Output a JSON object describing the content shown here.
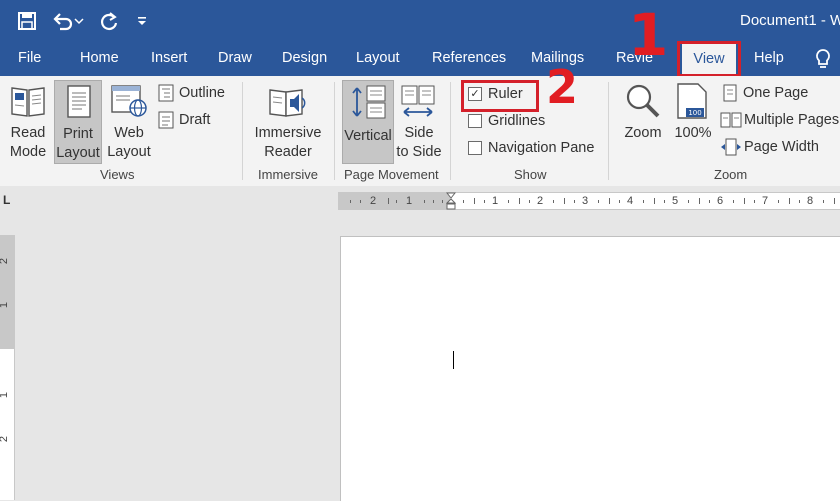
{
  "title_bar": {
    "document_title": "Document1  -  W",
    "icons": [
      "save-icon",
      "undo-icon",
      "undo-dropdown-icon",
      "redo-icon",
      "customize-qat-icon"
    ]
  },
  "tabs": [
    "File",
    "Home",
    "Insert",
    "Draw",
    "Design",
    "Layout",
    "References",
    "Mailings",
    "Revie",
    "View",
    "Help"
  ],
  "active_tab": "View",
  "tell_me_icon": "lightbulb-icon",
  "annotations": {
    "step1": "1",
    "step2": "2",
    "color": "#e11d22"
  },
  "ribbon": {
    "views": {
      "group_label": "Views",
      "read_mode": [
        "Read",
        "Mode"
      ],
      "print_layout": [
        "Print",
        "Layout"
      ],
      "web_layout": [
        "Web",
        "Layout"
      ],
      "outline": "Outline",
      "draft": "Draft"
    },
    "immersive": {
      "group_label": "Immersive",
      "immersive_reader": [
        "Immersive",
        "Reader"
      ]
    },
    "page_movement": {
      "group_label": "Page Movement",
      "vertical": "Vertical",
      "side_to_side": [
        "Side",
        "to Side"
      ]
    },
    "show": {
      "group_label": "Show",
      "ruler": "Ruler",
      "ruler_checked": true,
      "gridlines": "Gridlines",
      "gridlines_checked": false,
      "navigation_pane": "Navigation Pane",
      "navigation_checked": false
    },
    "zoom": {
      "group_label": "Zoom",
      "zoom": "Zoom",
      "hundred": "100%",
      "hundred_icon_text": "100",
      "one_page": "One Page",
      "multiple_pages": "Multiple Pages",
      "page_width": "Page Width"
    }
  },
  "ruler": {
    "tab_selector": "L",
    "h_left_numbers": [
      "2",
      "1"
    ],
    "h_right_numbers": [
      "1",
      "2",
      "3",
      "4",
      "5",
      "6",
      "7",
      "8"
    ],
    "v_numbers": [
      "2",
      "1",
      "1",
      "2"
    ]
  },
  "colors": {
    "accent": "#2b579a",
    "ribbon_bg": "#f3f3f3",
    "highlight": "#d4202a"
  }
}
